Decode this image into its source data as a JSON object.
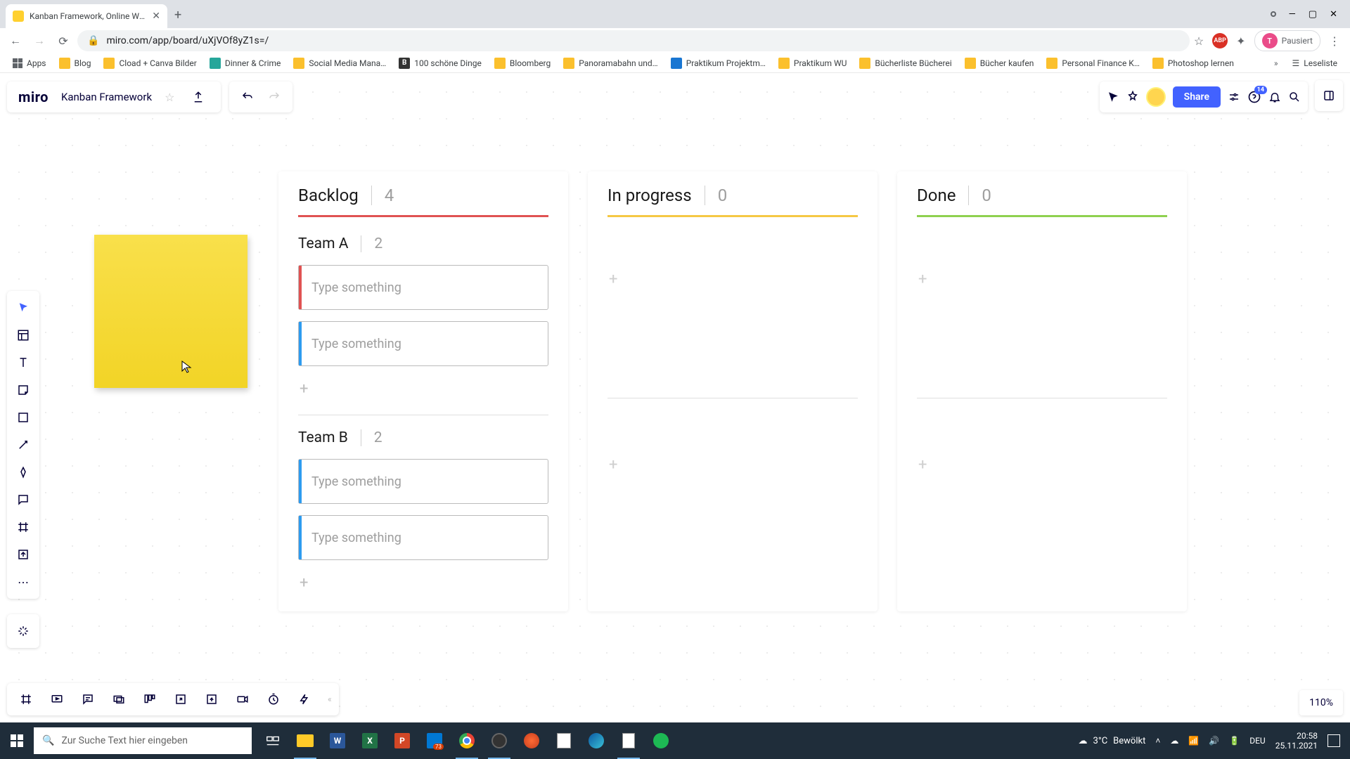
{
  "browser": {
    "tab_title": "Kanban Framework, Online Whit…",
    "url": "miro.com/app/board/uXjVOf8yZ1s=/",
    "profile_pause": "Pausiert",
    "bookmarks": [
      {
        "label": "Apps",
        "style": "grid"
      },
      {
        "label": "Blog",
        "style": "folder"
      },
      {
        "label": "Cload + Canva Bilder",
        "style": "folder"
      },
      {
        "label": "Dinner & Crime",
        "style": "teal"
      },
      {
        "label": "Social Media Mana…",
        "style": "folder"
      },
      {
        "label": "100 schöne Dinge",
        "style": "dark"
      },
      {
        "label": "Bloomberg",
        "style": "folder"
      },
      {
        "label": "Panoramabahn und…",
        "style": "folder"
      },
      {
        "label": "Praktikum Projektm…",
        "style": "blue"
      },
      {
        "label": "Praktikum WU",
        "style": "folder"
      },
      {
        "label": "Bücherliste Bücherei",
        "style": "folder"
      },
      {
        "label": "Bücher kaufen",
        "style": "folder"
      },
      {
        "label": "Personal Finance K…",
        "style": "folder"
      },
      {
        "label": "Photoshop lernen",
        "style": "folder"
      }
    ],
    "reading_list": "Leseliste"
  },
  "miro": {
    "logo": "miro",
    "board_name": "Kanban Framework",
    "share": "Share",
    "help_badge": "14",
    "zoom": "110%"
  },
  "kanban": {
    "columns": [
      {
        "title": "Backlog",
        "count": "4",
        "underline": "u-red"
      },
      {
        "title": "In progress",
        "count": "0",
        "underline": "u-yellow"
      },
      {
        "title": "Done",
        "count": "0",
        "underline": "u-green"
      }
    ],
    "teams": [
      {
        "name": "Team A",
        "count": "2",
        "cards": [
          {
            "placeholder": "Type something",
            "edge": "edge-red"
          },
          {
            "placeholder": "Type something",
            "edge": "edge-blue"
          }
        ]
      },
      {
        "name": "Team B",
        "count": "2",
        "cards": [
          {
            "placeholder": "Type something",
            "edge": "edge-blue"
          },
          {
            "placeholder": "Type something",
            "edge": "edge-blue"
          }
        ]
      }
    ]
  },
  "taskbar": {
    "search_placeholder": "Zur Suche Text hier eingeben",
    "weather_temp": "3°C",
    "weather_desc": "Bewölkt",
    "lang": "DEU",
    "time": "20:58",
    "date": "25.11.2021"
  }
}
